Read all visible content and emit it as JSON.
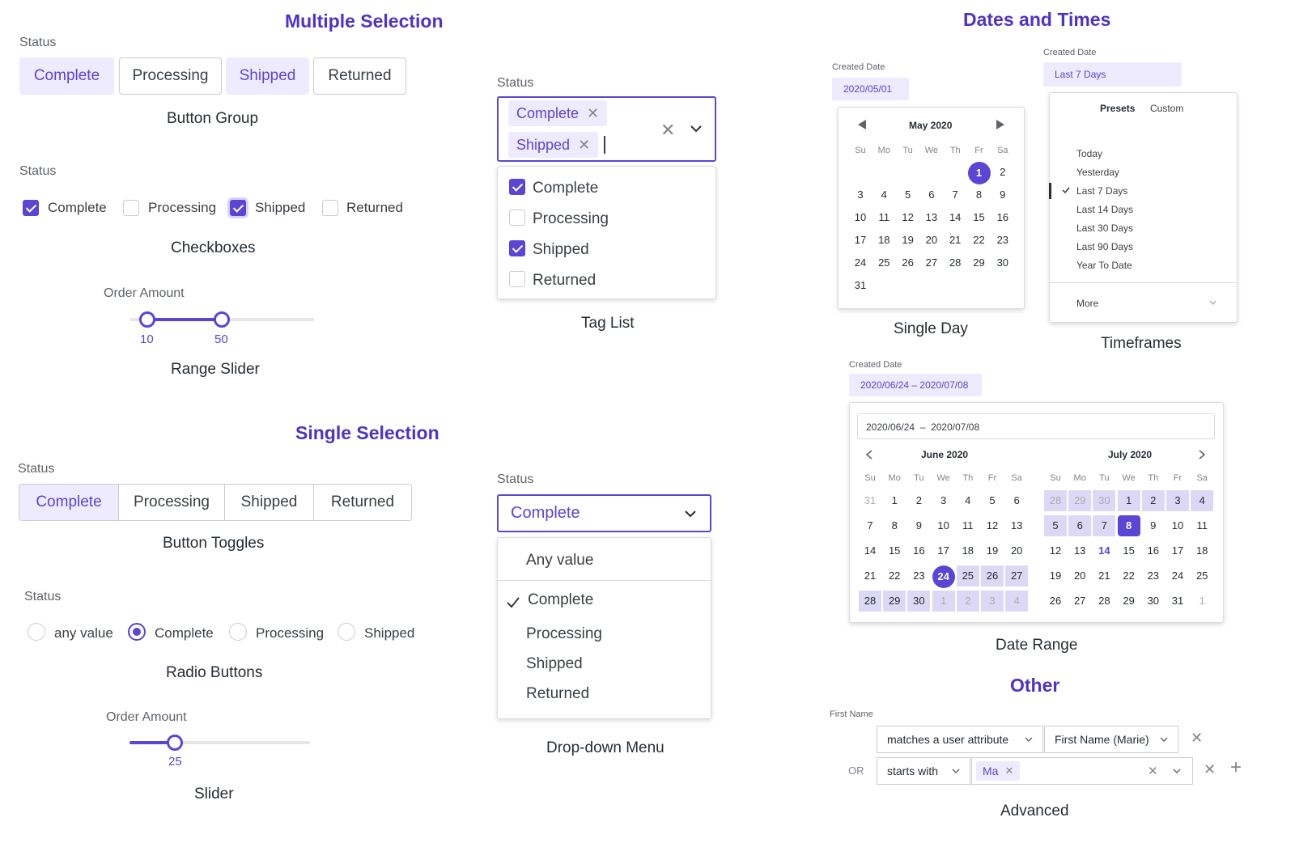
{
  "sections": {
    "multiple": "Multiple Selection",
    "single": "Single Selection",
    "dates": "Dates and Times",
    "other": "Other"
  },
  "status_label": "Status",
  "order_amount_label": "Order Amount",
  "created_date_label": "Created Date",
  "first_name_label": "First Name",
  "options": [
    "Complete",
    "Processing",
    "Shipped",
    "Returned"
  ],
  "any_value_lower": "any value",
  "any_value": "Any value",
  "captions": {
    "button_group": "Button Group",
    "checkboxes": "Checkboxes",
    "range_slider": "Range Slider",
    "tag_list": "Tag List",
    "button_toggles": "Button Toggles",
    "radio_buttons": "Radio Buttons",
    "slider": "Slider",
    "dropdown_menu": "Drop-down Menu",
    "single_day": "Single Day",
    "timeframes": "Timeframes",
    "date_range": "Date Range",
    "advanced": "Advanced"
  },
  "range_slider": {
    "min": "10",
    "max": "50"
  },
  "slider": {
    "value": "25"
  },
  "single_day": {
    "value": "2020/05/01",
    "month": "May 2020"
  },
  "weekdays": [
    "Su",
    "Mo",
    "Tu",
    "We",
    "Th",
    "Fr",
    "Sa"
  ],
  "timeframes": {
    "value": "Last 7 Days",
    "tabs": [
      "Presets",
      "Custom"
    ],
    "presets": [
      "Today",
      "Yesterday",
      "Last 7 Days",
      "Last 14 Days",
      "Last 30 Days",
      "Last 90 Days",
      "Year To Date"
    ],
    "more": "More"
  },
  "date_range": {
    "value": "2020/06/24 – 2020/07/08",
    "input": "2020/06/24  –  2020/07/08",
    "month_left": "June 2020",
    "month_right": "July 2020"
  },
  "advanced": {
    "op1": "matches a user attribute",
    "attr1": "First Name (Marie)",
    "or": "OR",
    "op2": "starts with",
    "chip": "Ma"
  },
  "colors": {
    "accent": "#5b45d4",
    "accent_light": "#eeeaff",
    "heading": "#4f33c4"
  }
}
